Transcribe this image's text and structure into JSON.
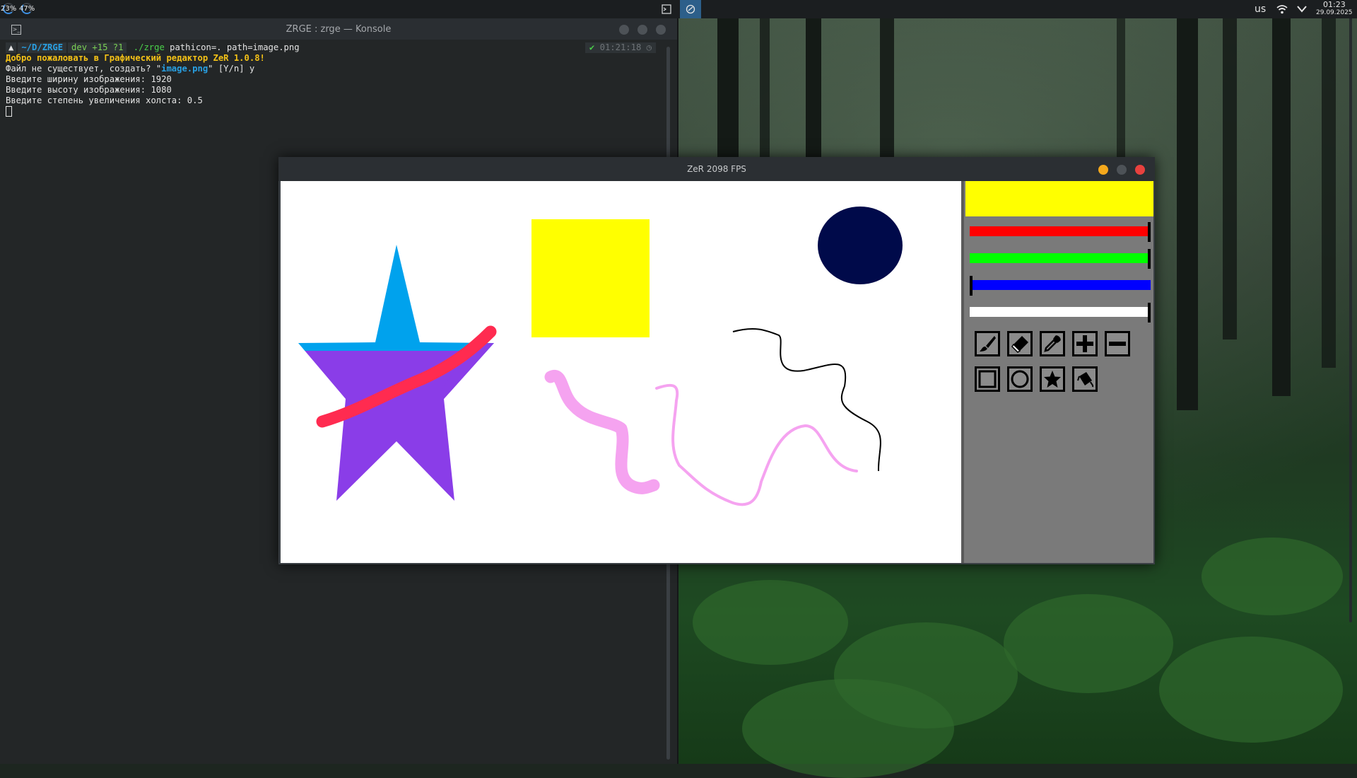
{
  "top_panel": {
    "cpu_text": "23%",
    "mem_text": "47%",
    "keyboard_layout": "us",
    "time": "01:23",
    "date": "29.09.2025"
  },
  "konsole": {
    "title": "ZRGE : zrge — Konsole",
    "prompt": {
      "path": "~/D/ZRGE",
      "git": "dev +15 ?1",
      "command": "./zrge",
      "args": " pathicon=. path=image.png",
      "status_time": "01:21:18"
    },
    "lines": {
      "welcome": "Добро пожаловать в Графический редактор ZeR 1.0.8!",
      "file_q_pre": "Файл не существует, создать? \"",
      "file_name": "image.png",
      "file_q_post": "\" [Y/n] y",
      "width": "Введите ширину изображения: 1920",
      "height": "Введите высоту изображения: 1080",
      "scale": "Введите степень увеличения холста: 0.5"
    }
  },
  "zer": {
    "title": "ZeR 2098 FPS",
    "current_color": "#ffff00",
    "sliders": [
      {
        "name": "red",
        "color": "#ff0000",
        "value": 255
      },
      {
        "name": "green",
        "color": "#00ff00",
        "value": 255
      },
      {
        "name": "blue",
        "color": "#0000ff",
        "value": 0
      },
      {
        "name": "alpha",
        "color": "#ffffff",
        "value": 255
      }
    ],
    "tools": [
      "brush-icon",
      "eraser-icon",
      "eyedropper-icon",
      "zoom-in-icon",
      "zoom-out-icon",
      "rectangle-icon",
      "circle-icon",
      "star-icon",
      "fill-bucket-icon"
    ]
  }
}
